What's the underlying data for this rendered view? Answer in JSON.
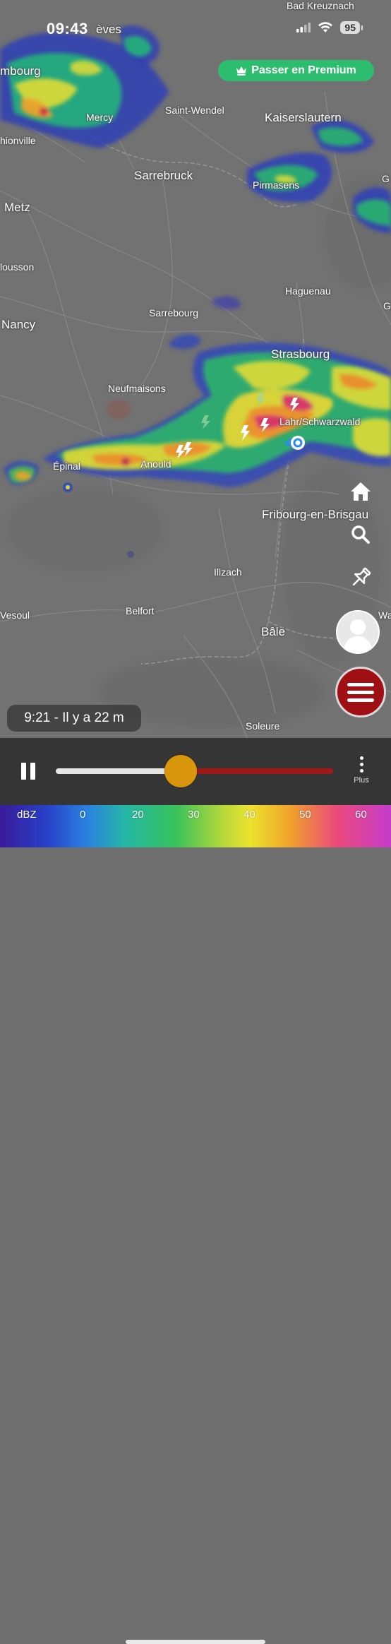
{
  "status_bar": {
    "time": "09:43",
    "battery": "95"
  },
  "premium_button": {
    "label": "Passer en Premium",
    "icon": "crown-icon"
  },
  "map": {
    "places": [
      {
        "id": "bad-kreuznach",
        "name": "Bad Kreuznach"
      },
      {
        "id": "treves",
        "name": "èves"
      },
      {
        "id": "luxembourg",
        "name": "mbourg"
      },
      {
        "id": "mercy",
        "name": "Mercy"
      },
      {
        "id": "saint-wendel",
        "name": "Saint-Wendel"
      },
      {
        "id": "kaiserslautern",
        "name": "Kaiserslautern"
      },
      {
        "id": "thionville",
        "name": "hionville"
      },
      {
        "id": "sarrebruck",
        "name": "Sarrebruck"
      },
      {
        "id": "pirmasens",
        "name": "Pirmasens"
      },
      {
        "id": "metz",
        "name": "Metz"
      },
      {
        "id": "pont-a-mousson",
        "name": "lousson"
      },
      {
        "id": "haguenau",
        "name": "Haguenau"
      },
      {
        "id": "sarrebourg",
        "name": "Sarrebourg"
      },
      {
        "id": "nancy",
        "name": "Nancy"
      },
      {
        "id": "strasbourg",
        "name": "Strasbourg"
      },
      {
        "id": "neufmaisons",
        "name": "Neufmaisons"
      },
      {
        "id": "lahr",
        "name": "Lahr/Schwarzwald"
      },
      {
        "id": "epinal",
        "name": "Épinal"
      },
      {
        "id": "anould",
        "name": "Anould"
      },
      {
        "id": "fribourg",
        "name": "Fribourg-en-Brisgau"
      },
      {
        "id": "illzach",
        "name": "Illzach"
      },
      {
        "id": "vesoul",
        "name": "Vesoul"
      },
      {
        "id": "belfort",
        "name": "Belfort"
      },
      {
        "id": "bale",
        "name": "Bâle"
      },
      {
        "id": "soleure",
        "name": "Soleure"
      },
      {
        "id": "waldshut",
        "name": "Walds"
      },
      {
        "id": "east-g1",
        "name": "G"
      },
      {
        "id": "east-g2",
        "name": "G"
      }
    ]
  },
  "side_buttons": {
    "home": "home-icon",
    "search": "search-icon",
    "pin": "pin-icon",
    "profile": "avatar",
    "menu": "menu-icon"
  },
  "time_pill": {
    "label": "9:21 - Il y a 22 m"
  },
  "player": {
    "progress": 0.45,
    "more_label": "Plus"
  },
  "legend": {
    "unit": "dBZ",
    "ticks": [
      "0",
      "20",
      "30",
      "40",
      "50",
      "60"
    ]
  },
  "colors": {
    "premium": "#2dbd6e",
    "menu_button": "#a00f14",
    "slider_thumb": "#d9950b",
    "slider_remaining": "#a11818",
    "location_dot": "#2b8de6"
  }
}
